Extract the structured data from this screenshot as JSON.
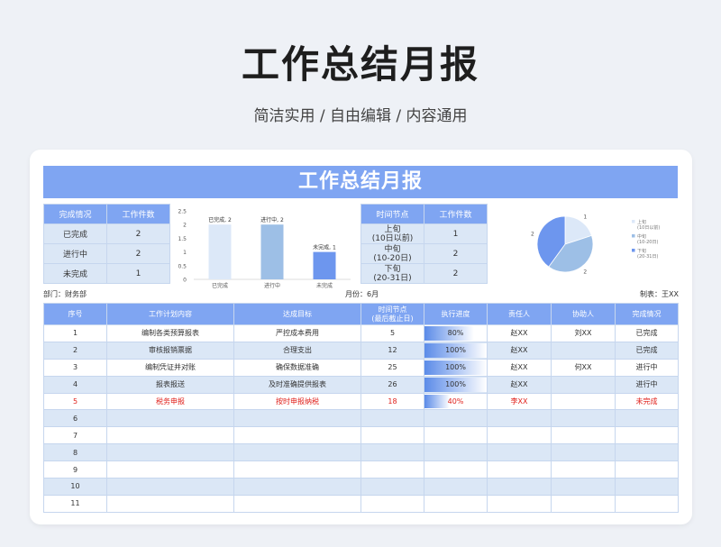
{
  "hero": {
    "title": "工作总结月报",
    "subtitle": "简洁实用 / 自由编辑 / 内容通用"
  },
  "banner": "工作总结月报",
  "status_table": {
    "headers": [
      "完成情况",
      "工作件数"
    ],
    "rows": [
      [
        "已完成",
        "2"
      ],
      [
        "进行中",
        "2"
      ],
      [
        "未完成",
        "1"
      ]
    ]
  },
  "period_table": {
    "headers": [
      "时间节点",
      "工作件数"
    ],
    "rows": [
      [
        "上旬",
        "(10日以前)",
        "1"
      ],
      [
        "中旬",
        "(10-20日)",
        "2"
      ],
      [
        "下旬",
        "(20-31日)",
        "2"
      ]
    ]
  },
  "meta": {
    "dept": "部门：财务部",
    "month": "月份：6月",
    "maker": "制表：王XX"
  },
  "main_table": {
    "headers": [
      "序号",
      "工作计划内容",
      "达成目标",
      "时间节点",
      "(最后截止日)",
      "执行进度",
      "责任人",
      "协助人",
      "完成情况"
    ],
    "rows": [
      {
        "no": "1",
        "plan": "编制各类预算报表",
        "goal": "严控成本费用",
        "day": "5",
        "progress": "80%",
        "progress_value": 0.8,
        "owner": "赵XX",
        "helper": "刘XX",
        "status": "已完成"
      },
      {
        "no": "2",
        "plan": "审核报销票据",
        "goal": "合理支出",
        "day": "12",
        "progress": "100%",
        "progress_value": 1.0,
        "owner": "赵XX",
        "helper": "",
        "status": "已完成"
      },
      {
        "no": "3",
        "plan": "编制凭证并对账",
        "goal": "确保数据准确",
        "day": "25",
        "progress": "100%",
        "progress_value": 1.0,
        "owner": "赵XX",
        "helper": "何XX",
        "status": "进行中"
      },
      {
        "no": "4",
        "plan": "报表报送",
        "goal": "及时准确提供报表",
        "day": "26",
        "progress": "100%",
        "progress_value": 1.0,
        "owner": "赵XX",
        "helper": "",
        "status": "进行中"
      },
      {
        "no": "5",
        "plan": "税务申报",
        "goal": "按时申报纳税",
        "day": "18",
        "progress": "40%",
        "progress_value": 0.4,
        "owner": "李XX",
        "helper": "",
        "status": "未完成",
        "alert": true
      },
      {
        "no": "6"
      },
      {
        "no": "7"
      },
      {
        "no": "8"
      },
      {
        "no": "9"
      },
      {
        "no": "10"
      },
      {
        "no": "11"
      }
    ]
  },
  "chart_data": [
    {
      "type": "bar",
      "categories": [
        "已完成",
        "进行中",
        "未完成"
      ],
      "values": [
        2,
        2,
        1
      ],
      "data_labels": [
        "已完成, 2",
        "进行中, 2",
        "未完成, 1"
      ],
      "ylim": [
        0,
        2.5
      ],
      "yticks": [
        "0",
        "0.5",
        "1",
        "1.5",
        "2",
        "2.5"
      ],
      "colors": [
        "#dce8f8",
        "#9dbfe6",
        "#6d96ee"
      ],
      "grid": false
    },
    {
      "type": "pie",
      "categories": [
        "上旬",
        "中旬",
        "下旬"
      ],
      "legend_sub": [
        "(10日以前)",
        "(10-20日)",
        "(20-31日)"
      ],
      "values": [
        1,
        2,
        2
      ],
      "data_labels": [
        "1",
        "2",
        "2"
      ],
      "colors": [
        "#dce8f8",
        "#9dbfe6",
        "#6d96ee"
      ],
      "legend": "right"
    }
  ]
}
